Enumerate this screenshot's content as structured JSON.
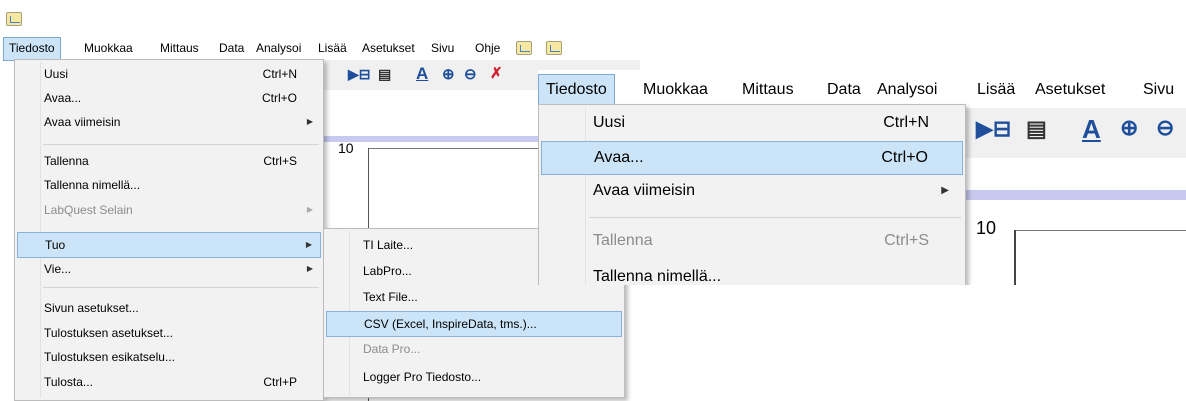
{
  "menubar": {
    "items": [
      "Tiedosto",
      "Muokkaa",
      "Mittaus",
      "Data",
      "Analysoi",
      "Lisää",
      "Asetukset",
      "Sivu",
      "Ohje"
    ],
    "active": "Tiedosto"
  },
  "file_menu": {
    "items": [
      {
        "label": "Uusi",
        "shortcut": "Ctrl+N"
      },
      {
        "label": "Avaa...",
        "shortcut": "Ctrl+O"
      },
      {
        "label": "Avaa viimeisin",
        "shortcut": ""
      },
      {
        "label": "Tallenna",
        "shortcut": "Ctrl+S"
      },
      {
        "label": "Tallenna nimellä...",
        "shortcut": ""
      },
      {
        "label": "LabQuest Selain",
        "shortcut": ""
      },
      {
        "label": "Tuo",
        "shortcut": ""
      },
      {
        "label": "Vie...",
        "shortcut": ""
      },
      {
        "label": "Sivun asetukset...",
        "shortcut": ""
      },
      {
        "label": "Tulostuksen asetukset...",
        "shortcut": ""
      },
      {
        "label": "Tulostuksen esikatselu...",
        "shortcut": ""
      },
      {
        "label": "Tulosta...",
        "shortcut": "Ctrl+P"
      }
    ]
  },
  "import_submenu": {
    "items": [
      "TI Laite...",
      "LabPro...",
      "Text File...",
      "CSV (Excel, InspireData, tms.)...",
      "Data Pro...",
      "Logger Pro Tiedosto..."
    ]
  },
  "zoomed_menu": {
    "items": [
      {
        "label": "Uusi",
        "shortcut": "Ctrl+N"
      },
      {
        "label": "Avaa...",
        "shortcut": "Ctrl+O"
      },
      {
        "label": "Avaa viimeisin",
        "shortcut": ""
      },
      {
        "label": "Tallenna",
        "shortcut": "Ctrl+S"
      },
      {
        "label": "Tallenna nimellä...",
        "shortcut": ""
      }
    ]
  },
  "graph": {
    "y_tick": "10"
  },
  "colors": {
    "highlight": "#cce4f7",
    "highlight_border": "#8ab1db",
    "menu_bg": "#f2f2f2",
    "graph_band": "#c7c9ef"
  },
  "icons": [
    "app-icon",
    "submenu-arrow-icon",
    "add-column-icon",
    "data-browser-icon",
    "autoscale-icon",
    "zoom-in-icon",
    "zoom-out-icon",
    "examine-icon"
  ]
}
